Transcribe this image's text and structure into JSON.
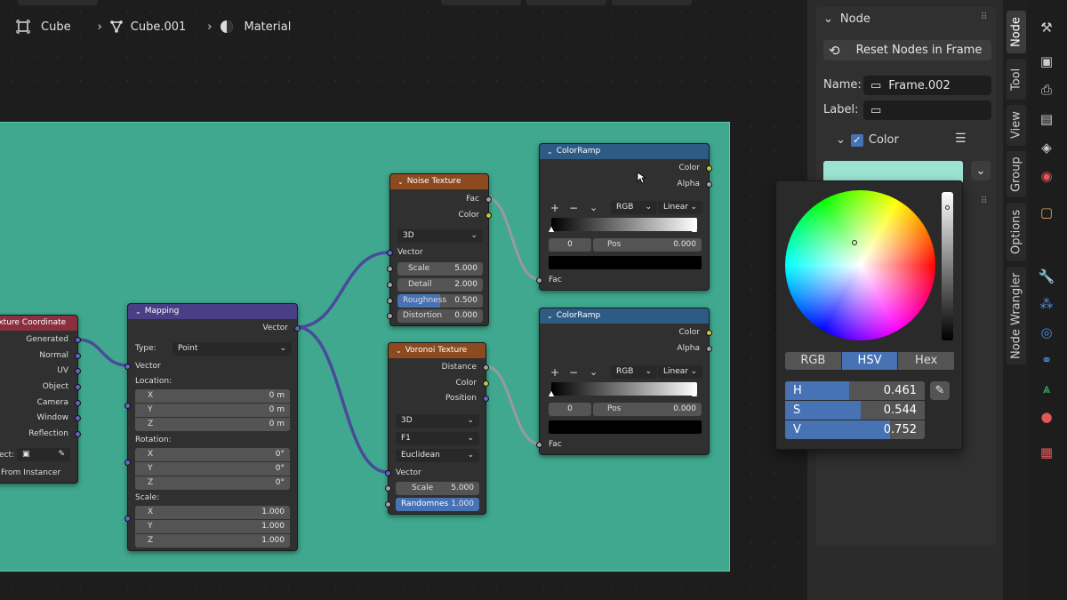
{
  "breadcrumb": {
    "object": "Cube",
    "mesh": "Cube.001",
    "material": "Material"
  },
  "nodes": {
    "noise": {
      "title": "Noise Texture",
      "out_fac": "Fac",
      "out_color": "Color",
      "dimensions": "3D",
      "in_vector": "Vector",
      "fields": [
        {
          "label": "Scale",
          "value": "5.000"
        },
        {
          "label": "Detail",
          "value": "2.000"
        },
        {
          "label": "Roughness",
          "value": "0.500"
        },
        {
          "label": "Distortion",
          "value": "0.000"
        }
      ]
    },
    "ramp1": {
      "title": "ColorRamp",
      "out_color": "Color",
      "out_alpha": "Alpha",
      "plus": "+",
      "minus": "−",
      "chev": "⌄",
      "mode": "RGB",
      "interp": "Linear",
      "index": "0",
      "pos_label": "Pos",
      "pos_value": "0.000",
      "in_fac": "Fac"
    },
    "ramp2": {
      "title": "ColorRamp",
      "out_color": "Color",
      "out_alpha": "Alpha",
      "plus": "+",
      "minus": "−",
      "chev": "⌄",
      "mode": "RGB",
      "interp": "Linear",
      "index": "0",
      "pos_label": "Pos",
      "pos_value": "0.000",
      "in_fac": "Fac"
    },
    "voronoi": {
      "title": "Voronoi Texture",
      "out_distance": "Distance",
      "out_color": "Color",
      "out_position": "Position",
      "dimensions": "3D",
      "feature": "F1",
      "metric": "Euclidean",
      "in_vector": "Vector",
      "fields": [
        {
          "label": "Scale",
          "value": "5.000"
        },
        {
          "label": "Randomnes",
          "value": "1.000"
        }
      ]
    },
    "mapping": {
      "title": "Mapping",
      "out_vector": "Vector",
      "type_label": "Type:",
      "type_value": "Point",
      "in_vector": "Vector",
      "location_label": "Location:",
      "location": [
        {
          "axis": "X",
          "value": "0 m"
        },
        {
          "axis": "Y",
          "value": "0 m"
        },
        {
          "axis": "Z",
          "value": "0 m"
        }
      ],
      "rotation_label": "Rotation:",
      "rotation": [
        {
          "axis": "X",
          "value": "0°"
        },
        {
          "axis": "Y",
          "value": "0°"
        },
        {
          "axis": "Z",
          "value": "0°"
        }
      ],
      "scale_label": "Scale:",
      "scale": [
        {
          "axis": "X",
          "value": "1.000"
        },
        {
          "axis": "Y",
          "value": "1.000"
        },
        {
          "axis": "Z",
          "value": "1.000"
        }
      ]
    },
    "texcoord": {
      "title": "Texture Coordinate",
      "outputs": [
        "Generated",
        "Normal",
        "UV",
        "Object",
        "Camera",
        "Window",
        "Reflection"
      ],
      "object_label": "ect:",
      "instancer": "From Instancer"
    }
  },
  "panel": {
    "section": "Node",
    "reset_button": "Reset Nodes in Frame",
    "name_label": "Name:",
    "name_value": "Frame.002",
    "label_label": "Label:",
    "label_value": "",
    "color_label": "Color",
    "color_checked": true,
    "swatch_color": "#9ce3d3"
  },
  "picker": {
    "modes": [
      "RGB",
      "HSV",
      "Hex"
    ],
    "active_mode": "HSV",
    "h_label": "H",
    "h_value": "0.461",
    "h_fraction": 0.461,
    "s_label": "S",
    "s_value": "0.544",
    "s_fraction": 0.544,
    "v_label": "V",
    "v_value": "0.752",
    "v_fraction": 0.752
  },
  "side_tabs": [
    "Node",
    "Tool",
    "View",
    "Group",
    "Options",
    "Node Wrangler"
  ],
  "side_tab_active": "Node",
  "colors": {
    "frame": "#3fa88f",
    "accent": "#4772b3",
    "noise_header": "#8c4a1e",
    "ramp_header": "#2e5b84",
    "mapping_header": "#4a3f86",
    "texcoord_header": "#8a2f3e"
  }
}
